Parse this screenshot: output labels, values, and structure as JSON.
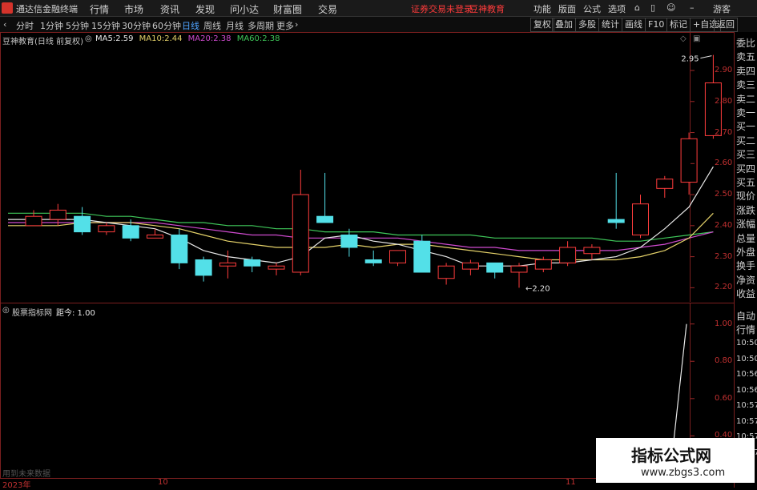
{
  "topbar": {
    "app_title": "通达信金融终端",
    "menu": [
      "行情",
      "市场",
      "资讯",
      "发现",
      "问小达",
      "财富圈",
      "交易"
    ],
    "login_warning": "证券交易未登录",
    "brand": "豆神教育",
    "right_menu": [
      "功能",
      "版面",
      "公式",
      "选项"
    ],
    "guest": "游客"
  },
  "toolbar": {
    "periods": [
      "分时",
      "1分钟",
      "5分钟",
      "15分钟",
      "30分钟",
      "60分钟",
      "日线",
      "周线",
      "月线",
      "多周期",
      "更多"
    ],
    "active_period": "日线",
    "right_buttons": [
      "复权",
      "叠加",
      "多股",
      "统计",
      "画线",
      "F10",
      "标记",
      "+自选",
      "返回"
    ]
  },
  "main_chart": {
    "stock_name": "豆神教育(日线 前复权)",
    "ma": [
      {
        "label": "MA5:",
        "value": "2.59",
        "color": "#e8e8e8"
      },
      {
        "label": "MA10:",
        "value": "2.44",
        "color": "#e6d36a"
      },
      {
        "label": "MA20:",
        "value": "2.38",
        "color": "#d04bd0"
      },
      {
        "label": "MA60:",
        "value": "2.38",
        "color": "#3fc85a"
      }
    ],
    "high_label": "2.95",
    "low_label": "2.20",
    "y_ticks": [
      "2.90",
      "2.80",
      "2.70",
      "2.60",
      "2.50",
      "2.40",
      "2.30",
      "2.20"
    ]
  },
  "chart_data": {
    "type": "candlestick",
    "ylim": [
      2.17,
      2.98
    ],
    "candles": [
      {
        "o": 2.4,
        "h": 2.45,
        "l": 2.4,
        "c": 2.43
      },
      {
        "o": 2.42,
        "h": 2.47,
        "l": 2.4,
        "c": 2.45
      },
      {
        "o": 2.43,
        "h": 2.46,
        "l": 2.37,
        "c": 2.38
      },
      {
        "o": 2.38,
        "h": 2.41,
        "l": 2.37,
        "c": 2.4
      },
      {
        "o": 2.4,
        "h": 2.42,
        "l": 2.35,
        "c": 2.36
      },
      {
        "o": 2.36,
        "h": 2.39,
        "l": 2.36,
        "c": 2.37
      },
      {
        "o": 2.37,
        "h": 2.39,
        "l": 2.26,
        "c": 2.28
      },
      {
        "o": 2.29,
        "h": 2.3,
        "l": 2.22,
        "c": 2.24
      },
      {
        "o": 2.27,
        "h": 2.32,
        "l": 2.23,
        "c": 2.28
      },
      {
        "o": 2.29,
        "h": 2.3,
        "l": 2.25,
        "c": 2.27
      },
      {
        "o": 2.26,
        "h": 2.28,
        "l": 2.24,
        "c": 2.27
      },
      {
        "o": 2.25,
        "h": 2.58,
        "l": 2.24,
        "c": 2.5
      },
      {
        "o": 2.43,
        "h": 2.57,
        "l": 2.41,
        "c": 2.41
      },
      {
        "o": 2.37,
        "h": 2.39,
        "l": 2.3,
        "c": 2.33
      },
      {
        "o": 2.29,
        "h": 2.32,
        "l": 2.27,
        "c": 2.28
      },
      {
        "o": 2.28,
        "h": 2.32,
        "l": 2.27,
        "c": 2.32
      },
      {
        "o": 2.35,
        "h": 2.37,
        "l": 2.25,
        "c": 2.25
      },
      {
        "o": 2.23,
        "h": 2.28,
        "l": 2.21,
        "c": 2.27
      },
      {
        "o": 2.26,
        "h": 2.29,
        "l": 2.24,
        "c": 2.28
      },
      {
        "o": 2.28,
        "h": 2.28,
        "l": 2.23,
        "c": 2.25
      },
      {
        "o": 2.25,
        "h": 2.28,
        "l": 2.2,
        "c": 2.27
      },
      {
        "o": 2.26,
        "h": 2.3,
        "l": 2.25,
        "c": 2.29
      },
      {
        "o": 2.28,
        "h": 2.35,
        "l": 2.27,
        "c": 2.33
      },
      {
        "o": 2.31,
        "h": 2.34,
        "l": 2.29,
        "c": 2.33
      },
      {
        "o": 2.42,
        "h": 2.57,
        "l": 2.39,
        "c": 2.41
      },
      {
        "o": 2.37,
        "h": 2.5,
        "l": 2.36,
        "c": 2.47
      },
      {
        "o": 2.52,
        "h": 2.56,
        "l": 2.49,
        "c": 2.55
      },
      {
        "o": 2.54,
        "h": 2.7,
        "l": 2.5,
        "c": 2.68
      },
      {
        "o": 2.69,
        "h": 2.95,
        "l": 2.68,
        "c": 2.86
      }
    ],
    "ma5": [
      2.42,
      2.42,
      2.42,
      2.41,
      2.4,
      2.39,
      2.36,
      2.32,
      2.3,
      2.29,
      2.28,
      2.3,
      2.36,
      2.37,
      2.35,
      2.34,
      2.32,
      2.3,
      2.27,
      2.27,
      2.27,
      2.28,
      2.28,
      2.29,
      2.3,
      2.33,
      2.39,
      2.46,
      2.59
    ],
    "ma10": [
      2.4,
      2.4,
      2.41,
      2.41,
      2.41,
      2.4,
      2.39,
      2.37,
      2.35,
      2.34,
      2.33,
      2.33,
      2.33,
      2.34,
      2.33,
      2.34,
      2.34,
      2.33,
      2.32,
      2.31,
      2.3,
      2.29,
      2.29,
      2.29,
      2.29,
      2.3,
      2.32,
      2.36,
      2.44
    ],
    "ma20": [
      2.41,
      2.41,
      2.41,
      2.41,
      2.41,
      2.41,
      2.4,
      2.39,
      2.38,
      2.37,
      2.37,
      2.36,
      2.36,
      2.36,
      2.36,
      2.36,
      2.35,
      2.34,
      2.33,
      2.33,
      2.32,
      2.32,
      2.32,
      2.32,
      2.32,
      2.33,
      2.34,
      2.36,
      2.38
    ],
    "ma60": [
      2.44,
      2.44,
      2.44,
      2.43,
      2.43,
      2.42,
      2.41,
      2.41,
      2.4,
      2.4,
      2.39,
      2.39,
      2.38,
      2.38,
      2.38,
      2.37,
      2.37,
      2.37,
      2.37,
      2.36,
      2.36,
      2.36,
      2.36,
      2.36,
      2.35,
      2.35,
      2.36,
      2.37,
      2.38
    ],
    "indicator": {
      "name": "股票指标网",
      "label": "距今:",
      "value": "1.00",
      "ylim": [
        0.2,
        1.05
      ],
      "y_ticks": [
        "1.00",
        "0.80",
        "0.60",
        "0.40"
      ]
    },
    "x_labels": [
      "2023年",
      "10",
      "11"
    ]
  },
  "indicator_panel": {
    "title": "股票指标网",
    "label_text": "距今: 1.00",
    "y_ticks": [
      "1.00",
      "0.80",
      "0.60",
      "0.40"
    ],
    "footer_note": "用到未来数据"
  },
  "side_panel": {
    "labels": [
      "委比",
      "卖五",
      "卖四",
      "卖三",
      "卖二",
      "卖一",
      "买一",
      "买二",
      "买三",
      "买四",
      "买五",
      "现价",
      "涨跌",
      "涨幅",
      "总量",
      "外盘",
      "换手",
      "净资",
      "收益"
    ],
    "bottom_labels": [
      "自动",
      "行情"
    ],
    "times": [
      "10:50",
      "10:50",
      "10:56",
      "10:56",
      "10:57",
      "10:57",
      "10:57",
      "10:57"
    ]
  },
  "watermark": {
    "title": "指标公式网",
    "url": "www.zbgs3.com"
  }
}
